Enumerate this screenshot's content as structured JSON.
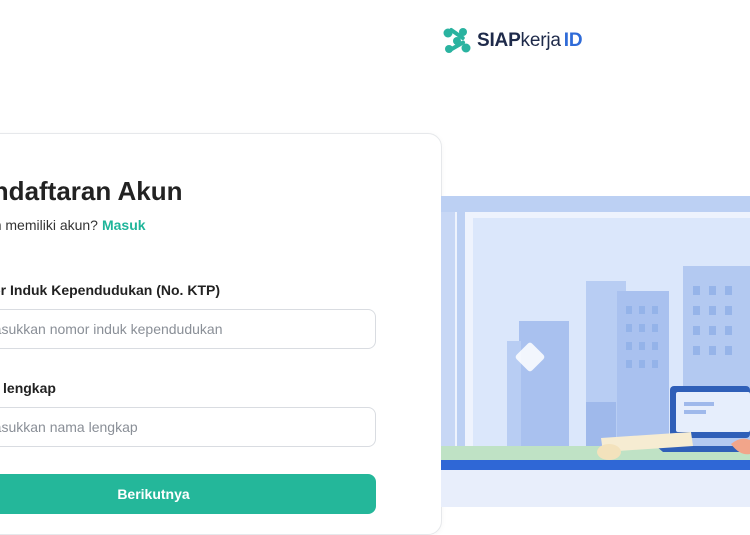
{
  "brand": {
    "siap": "SIAP",
    "kerja": "kerja",
    "id": "ID",
    "colors": {
      "teal": "#2ab3a0",
      "navy": "#1e2a4a",
      "blue": "#2f6bd8"
    }
  },
  "form": {
    "title": "Pendaftaran Akun",
    "login_prompt": "Sudah memiliki akun?",
    "login_link": "Masuk",
    "ktp": {
      "label": "Nomor Induk Kependudukan (No. KTP)",
      "placeholder": "Masukkan nomor induk kependudukan",
      "value": ""
    },
    "name": {
      "label": "Nama lengkap",
      "placeholder": "Masukkan nama lengkap",
      "value": ""
    },
    "submit_label": "Berikutnya",
    "accent": "#24b79a"
  },
  "illustration": {
    "subject": "city-office-desk-scene",
    "colors": {
      "sky": "#dbe7fb",
      "buildings": "#a9c1ef",
      "frame": "#bcd0f3",
      "desk": "#2f67d6"
    }
  }
}
